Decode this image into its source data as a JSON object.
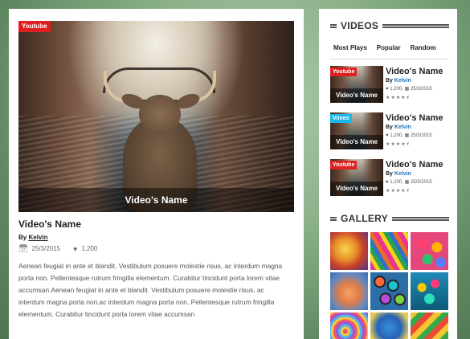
{
  "main_post": {
    "tag": "Youtube",
    "caption": "Video's Name",
    "title": "Video's Name",
    "by_label": "By",
    "author": "Kelvin",
    "date": "25/3/2015",
    "likes": "1,200",
    "body": "Aenean feugiat in ante et blandit. Vestibulum posuere molestie risus, ac interdum magna porta non. Pellentesque rutrum fringilla elementum. Curabitur tincidunt porta lorem vitae accumsan.Aenean feugiat in ante et blandit. Vestibulum posuere molestie risus, ac interdum magna porta non.ac interdum magna porta non. Pellentesque rutrum fringilla elementum. Curabitur tincidunt porta lorem vitae accumsan"
  },
  "videos_section": {
    "heading": "VIDEOS",
    "tabs": [
      "Most Plays",
      "Popular",
      "Random"
    ],
    "items": [
      {
        "tag": "Youtube",
        "tag_color": "#e02020",
        "caption": "Video's Name",
        "title": "Video's Name",
        "by_label": "By",
        "author": "Kelvin",
        "likes": "1,200",
        "date": "25/3/2015",
        "rating": 4.5
      },
      {
        "tag": "Vimeo",
        "tag_color": "#1ab7ea",
        "caption": "Video's Name",
        "title": "Video's Name",
        "by_label": "By",
        "author": "Kelvin",
        "likes": "1,200",
        "date": "25/3/2015",
        "rating": 4.5
      },
      {
        "tag": "Youtube",
        "tag_color": "#e02020",
        "caption": "Video's Name",
        "title": "Video's Name",
        "by_label": "By",
        "author": "Kelvin",
        "likes": "1,200",
        "date": "25/3/2015",
        "rating": 4.5
      }
    ]
  },
  "gallery_section": {
    "heading": "GALLERY",
    "image_count": 9
  },
  "icons": {
    "calendar": "calendar-icon",
    "heart": "heart-icon",
    "star": "star-icon"
  }
}
